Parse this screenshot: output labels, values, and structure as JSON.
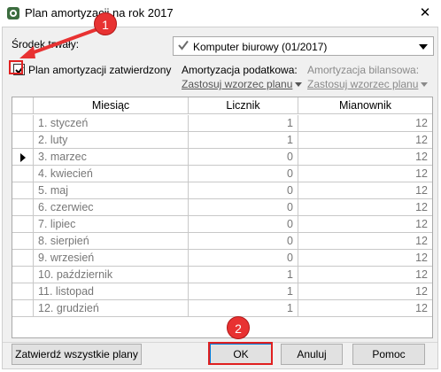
{
  "window": {
    "title": "Plan amortyzacji na rok 2017",
    "close_glyph": "✕"
  },
  "asset": {
    "label": "Środek trwały:",
    "selected": "Komputer biurowy (01/2017)"
  },
  "approved": {
    "label": "Plan amortyzacji zatwierdzony",
    "checked": true
  },
  "tax": {
    "label": "Amortyzacja podatkowa:",
    "link": "Zastosuj wzorzec planu"
  },
  "balance": {
    "label": "Amortyzacja bilansowa:",
    "link": "Zastosuj wzorzec planu"
  },
  "grid": {
    "headers": {
      "month": "Miesiąc",
      "numerator": "Licznik",
      "denominator": "Mianownik"
    },
    "rows": [
      {
        "month": "1. styczeń",
        "num": "1",
        "den": "12",
        "current": false
      },
      {
        "month": "2. luty",
        "num": "1",
        "den": "12",
        "current": false
      },
      {
        "month": "3. marzec",
        "num": "0",
        "den": "12",
        "current": true
      },
      {
        "month": "4. kwiecień",
        "num": "0",
        "den": "12",
        "current": false
      },
      {
        "month": "5. maj",
        "num": "0",
        "den": "12",
        "current": false
      },
      {
        "month": "6. czerwiec",
        "num": "0",
        "den": "12",
        "current": false
      },
      {
        "month": "7. lipiec",
        "num": "0",
        "den": "12",
        "current": false
      },
      {
        "month": "8. sierpień",
        "num": "0",
        "den": "12",
        "current": false
      },
      {
        "month": "9. wrzesień",
        "num": "0",
        "den": "12",
        "current": false
      },
      {
        "month": "10. październik",
        "num": "1",
        "den": "12",
        "current": false
      },
      {
        "month": "11. listopad",
        "num": "1",
        "den": "12",
        "current": false
      },
      {
        "month": "12. grudzień",
        "num": "1",
        "den": "12",
        "current": false
      }
    ]
  },
  "buttons": {
    "approve_all": "Zatwierdź wszystkie plany",
    "ok": "OK",
    "cancel": "Anuluj",
    "help": "Pomoc"
  },
  "annotations": {
    "badge1": "1",
    "badge2": "2",
    "color": "#e83232"
  }
}
